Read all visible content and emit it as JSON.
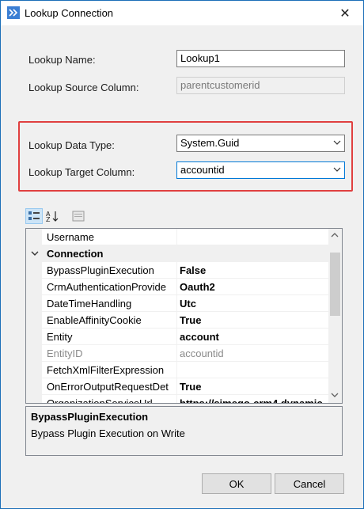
{
  "window": {
    "title": "Lookup Connection",
    "close_glyph": "✕"
  },
  "form": {
    "lookup_name_label": "Lookup Name:",
    "lookup_name_value": "Lookup1",
    "source_column_label": "Lookup Source Column:",
    "source_column_value": "parentcustomerid",
    "data_type_label": "Lookup Data Type:",
    "data_type_value": "System.Guid",
    "target_column_label": "Lookup Target Column:",
    "target_column_value": "accountid"
  },
  "grid": {
    "rows": [
      {
        "name": "Username",
        "value": ""
      },
      {
        "name": "Connection",
        "category": true
      },
      {
        "name": "BypassPluginExecution",
        "value": "False"
      },
      {
        "name": "CrmAuthenticationProvide",
        "value": "Oauth2"
      },
      {
        "name": "DateTimeHandling",
        "value": "Utc"
      },
      {
        "name": "EnableAffinityCookie",
        "value": "True"
      },
      {
        "name": "Entity",
        "value": "account"
      },
      {
        "name": "EntityID",
        "value": "accountid",
        "readonly": true
      },
      {
        "name": "FetchXmlFilterExpression",
        "value": ""
      },
      {
        "name": "OnErrorOutputRequestDet",
        "value": "True"
      },
      {
        "name": "OrganizationServiceUrl",
        "value": "https://simego-crm4.dynamic"
      }
    ]
  },
  "help": {
    "title": "BypassPluginExecution",
    "description": "Bypass Plugin Execution on Write"
  },
  "buttons": {
    "ok": "OK",
    "cancel": "Cancel"
  },
  "colors": {
    "highlight_border": "#e04040",
    "accent": "#0078d7"
  }
}
